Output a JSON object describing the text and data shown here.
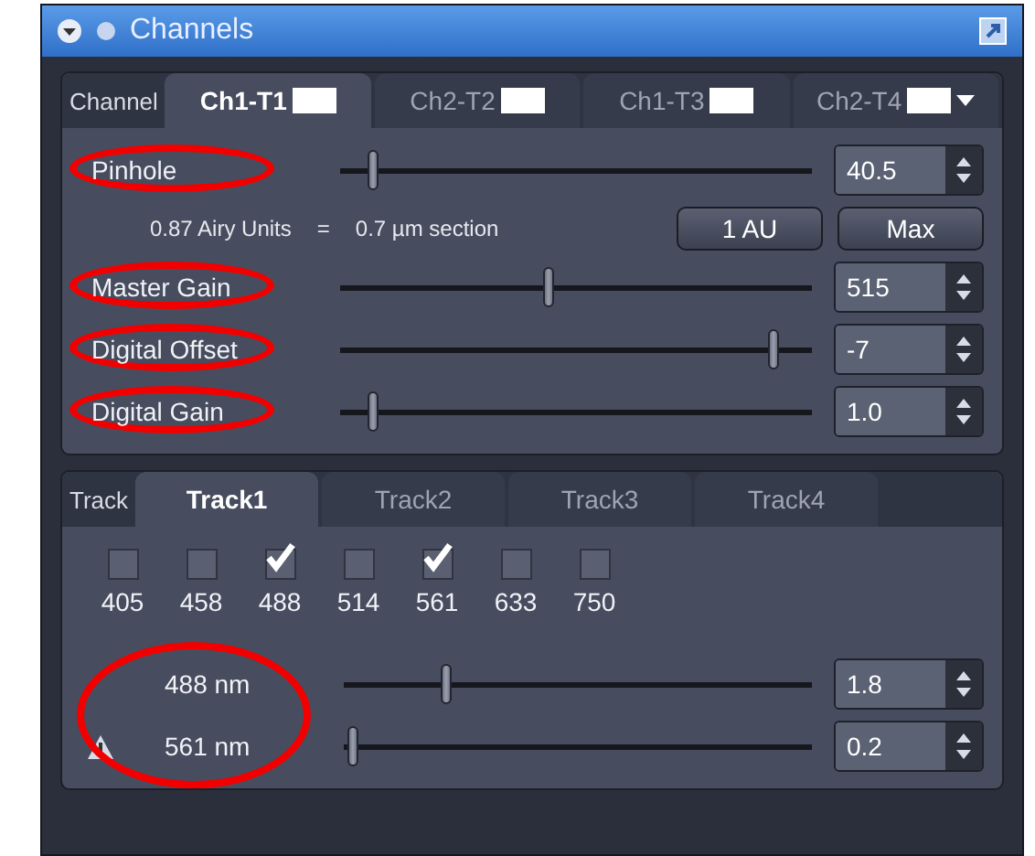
{
  "window": {
    "title": "Channels"
  },
  "channel_tabs": {
    "label": "Channel",
    "tabs": [
      {
        "label": "Ch1-T1",
        "selected": true
      },
      {
        "label": "Ch2-T2",
        "selected": false
      },
      {
        "label": "Ch1-T3",
        "selected": false
      },
      {
        "label": "Ch2-T4",
        "selected": false
      }
    ]
  },
  "pinhole": {
    "label": "Pinhole",
    "highlighted": true,
    "level": 0.07,
    "value": "40.5",
    "airy": "0.87 Airy Units",
    "equals": "=",
    "section": "0.7 µm section",
    "buttons": [
      "1 AU",
      "Max"
    ]
  },
  "sliders": [
    {
      "label": "Master Gain",
      "highlighted": true,
      "level": 0.44,
      "value": "515"
    },
    {
      "label": "Digital Offset",
      "highlighted": true,
      "level": 0.92,
      "value": "-7"
    },
    {
      "label": "Digital Gain",
      "highlighted": true,
      "level": 0.07,
      "value": "1.0"
    }
  ],
  "track_tabs": {
    "label": "Track",
    "tabs": [
      {
        "label": "Track1",
        "selected": true
      },
      {
        "label": "Track2",
        "selected": false
      },
      {
        "label": "Track3",
        "selected": false
      },
      {
        "label": "Track4",
        "selected": false
      }
    ]
  },
  "laser_lines": [
    {
      "label": "405",
      "checked": false
    },
    {
      "label": "458",
      "checked": false
    },
    {
      "label": "488",
      "checked": true
    },
    {
      "label": "514",
      "checked": false
    },
    {
      "label": "561",
      "checked": true
    },
    {
      "label": "633",
      "checked": false
    },
    {
      "label": "750",
      "checked": false
    }
  ],
  "lasers_highlighted": true,
  "lasers": [
    {
      "label": "488 nm",
      "warning": false,
      "level": 0.22,
      "value": "1.8"
    },
    {
      "label": "561 nm",
      "warning": true,
      "level": 0.02,
      "value": "0.2"
    }
  ]
}
